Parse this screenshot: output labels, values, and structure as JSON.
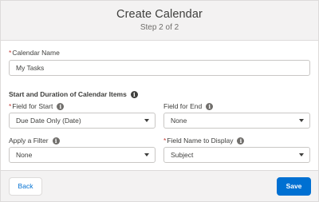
{
  "header": {
    "title": "Create Calendar",
    "step": "Step 2 of 2"
  },
  "form": {
    "calendar_name": {
      "label": "Calendar Name",
      "value": "My Tasks",
      "required": true
    },
    "section_heading": "Start and Duration of Calendar Items",
    "field_for_start": {
      "label": "Field for Start",
      "value": "Due Date Only (Date)",
      "required": true
    },
    "field_for_end": {
      "label": "Field for End",
      "value": "None"
    },
    "apply_filter": {
      "label": "Apply a Filter",
      "value": "None"
    },
    "field_name_to_display": {
      "label": "Field Name to Display",
      "value": "Subject",
      "required": true
    },
    "required_marker": "*",
    "info_glyph": "i"
  },
  "footer": {
    "back_label": "Back",
    "save_label": "Save"
  },
  "colors": {
    "brand": "#0070d2",
    "required": "#c23934",
    "header_bg": "#f3f2f2"
  },
  "icons": {
    "info": "info-icon",
    "dropdown": "chevron-down-icon"
  }
}
